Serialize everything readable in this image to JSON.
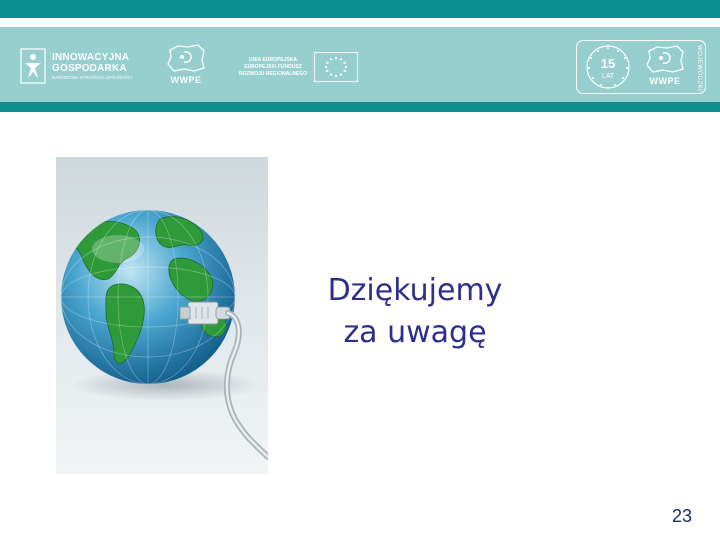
{
  "header": {
    "logo_innowacyjna": {
      "line1": "INNOWACYJNA",
      "line2": "GOSPODARKA",
      "line3": "NARODOWA STRATEGIA SPÓJNOŚCI"
    },
    "wwpe_logo_left": {
      "label": "WWPE"
    },
    "eu_block": {
      "line1": "UNIA EUROPEJSKA",
      "line2": "EUROPEJSKI FUNDUSZ",
      "line3": "ROZWOJU REGIONALNEGO"
    },
    "anniversary": {
      "number": "15",
      "label": "LAT",
      "wwpe_label": "WWPE",
      "vertical_text": "WOJEWÓDZKI"
    },
    "colors": {
      "bar": "#0e8f8f",
      "band": "#96cfcd"
    }
  },
  "main": {
    "image": {
      "icon": "globe-with-ethernet-cable"
    },
    "thanks_line1": "Dziękujemy",
    "thanks_line2": "za uwagę"
  },
  "footer": {
    "page_number": "23"
  }
}
